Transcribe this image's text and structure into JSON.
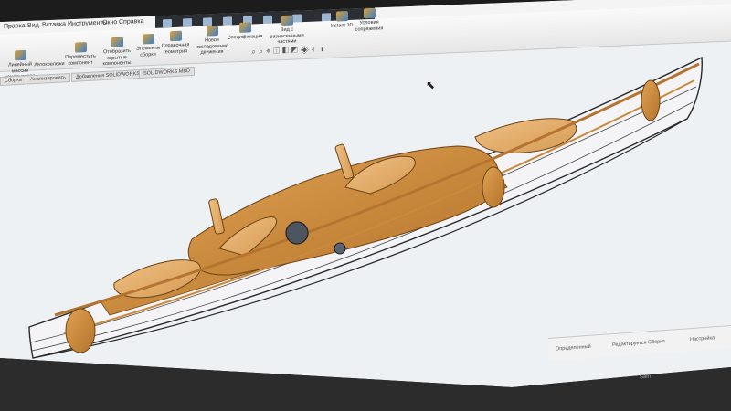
{
  "menu": [
    "Правка",
    "Вид",
    "Вставка",
    "Инструменты",
    "Окно",
    "Справка"
  ],
  "ribbon": {
    "insert_components": "Линейный массив компонентов",
    "move_component": "Переместить компонент",
    "smartfasteners": "Автокрепежи",
    "show_hidden": "Отобразить скрытые компоненты",
    "assembly_features": "Элементы сборки",
    "ref_geometry": "Справочная геометрия",
    "new_motion_study": "Новое исследование движения",
    "bom": "Спецификация",
    "exploded_view": "Вид с разнесенными частями",
    "instant3d": "Instant 3D",
    "mate_conditions": "Условия сопряжения"
  },
  "tabs": [
    "Сборка",
    "Анализировать",
    "Добавления SOLIDWORKS",
    "SOLIDWORKS MBD"
  ],
  "status": {
    "state": "Определенный",
    "mode": "Редактируется Сборка",
    "settings": "Настройка"
  },
  "monitor_label": "Sam"
}
